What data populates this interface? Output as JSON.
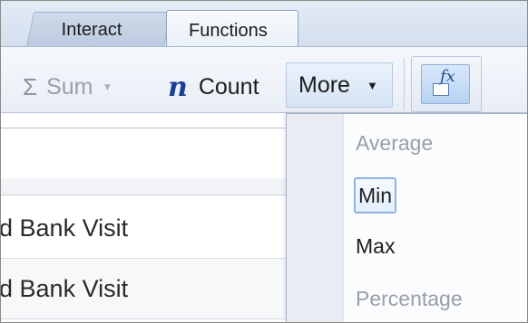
{
  "tabs": [
    {
      "label": "Interact"
    },
    {
      "label": "Functions"
    }
  ],
  "ribbon": {
    "sum_label": "Sum",
    "count_label": "Count",
    "more_label": "More",
    "icons": {
      "sum": "sigma-icon",
      "count": "count-n-icon",
      "insert_function": "fx-icon"
    }
  },
  "grid": {
    "rows": [
      {
        "text": "od Bank Visit"
      },
      {
        "text": "od Bank Visit"
      }
    ]
  },
  "menu": {
    "items": [
      {
        "label": "Average",
        "enabled": false
      },
      {
        "label": "Min",
        "enabled": true,
        "highlighted": true
      },
      {
        "label": "Max",
        "enabled": true
      },
      {
        "label": "Percentage",
        "enabled": false
      }
    ]
  },
  "colors": {
    "accent": "#1b3e96",
    "ribbon_bg": "#e9eef6",
    "highlight_border": "#8fb3e2"
  }
}
